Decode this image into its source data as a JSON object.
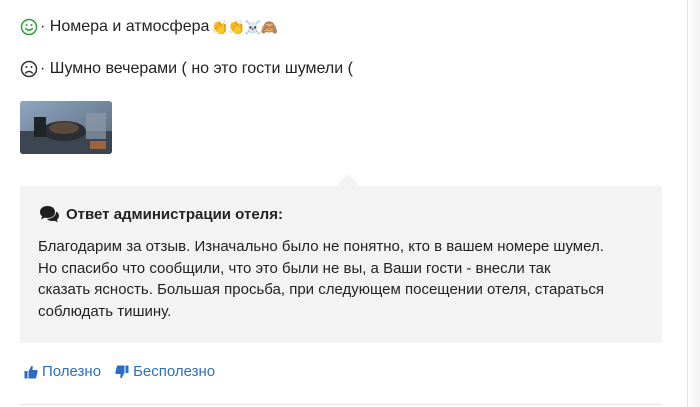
{
  "review": {
    "pros": {
      "text": "· Номера и атмосфера",
      "emoji": "👏👏☠️🙈",
      "icon": "smile-face-icon"
    },
    "cons": {
      "text": "· Шумно вечерами ( но это гости шумели (",
      "icon": "sad-face-icon"
    },
    "photo_icon": "photo-thumbnail"
  },
  "reply": {
    "title": "Ответ администрации отеля:",
    "icon": "chat-bubbles-icon",
    "lines": [
      "Благодарим за отзыв. Изначально было не понятно, кто в вашем номере шумел.",
      "Но спасибо что сообщили, что это были не вы, а Ваши гости - внесли так",
      "сказать ясность. Большая просьба, при следующем посещении отеля, стараться",
      "соблюдать тишину."
    ]
  },
  "votes": {
    "helpful_label": "Полезно",
    "unhelpful_label": "Бесполезно"
  },
  "colors": {
    "positive": "#2e9e3a",
    "negative": "#333333",
    "link": "#2a6fbf",
    "reply_bg": "#f3f3f3"
  }
}
